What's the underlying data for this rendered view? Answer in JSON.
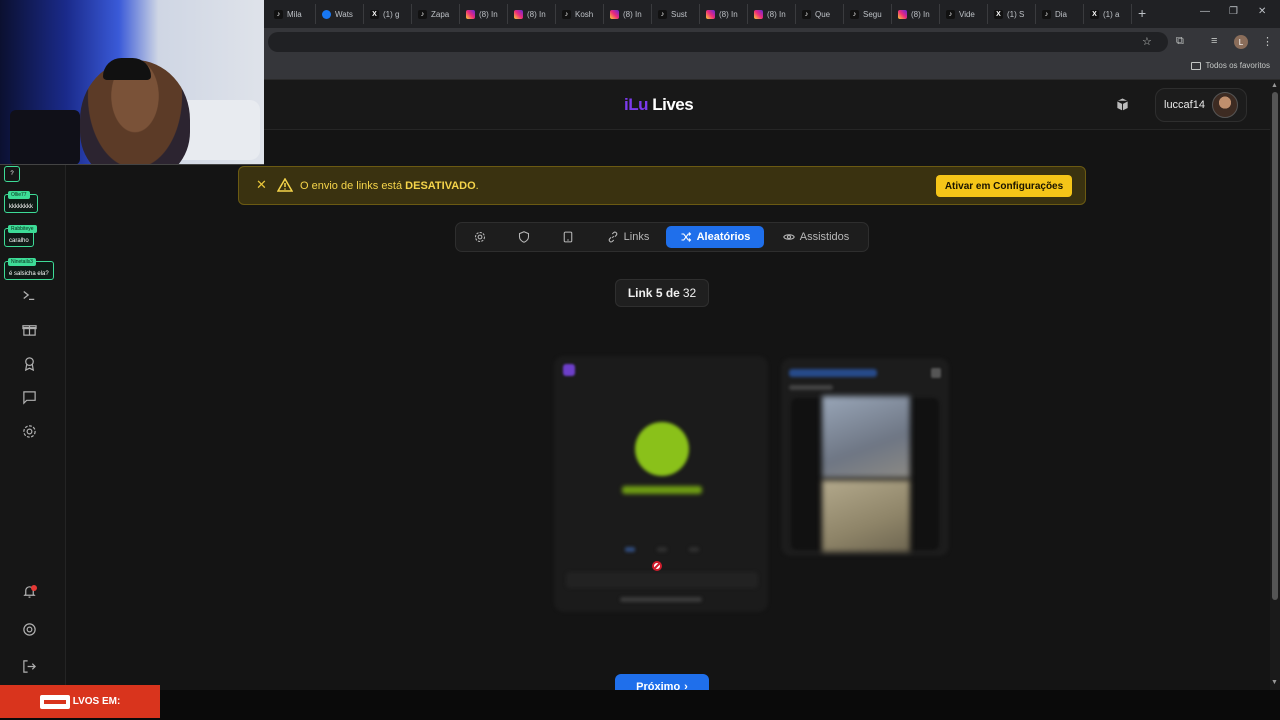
{
  "browser": {
    "tabs": [
      {
        "icon": "tiktok-icon",
        "label": "Mila"
      },
      {
        "icon": "meta-icon",
        "label": "Wats"
      },
      {
        "icon": "x-icon",
        "label": "(1) g"
      },
      {
        "icon": "tiktok-icon",
        "label": "Zapa"
      },
      {
        "icon": "instagram-icon",
        "label": "(8) In"
      },
      {
        "icon": "instagram-icon",
        "label": "(8) In"
      },
      {
        "icon": "tiktok-icon",
        "label": "Kosh"
      },
      {
        "icon": "instagram-icon",
        "label": "(8) In"
      },
      {
        "icon": "tiktok-icon",
        "label": "Sust"
      },
      {
        "icon": "instagram-icon",
        "label": "(8) In"
      },
      {
        "icon": "instagram-icon",
        "label": "(8) In"
      },
      {
        "icon": "tiktok-icon",
        "label": "Que"
      },
      {
        "icon": "tiktok-icon",
        "label": "Segu"
      },
      {
        "icon": "instagram-icon",
        "label": "(8) In"
      },
      {
        "icon": "tiktok-icon",
        "label": "Vide"
      },
      {
        "icon": "x-icon",
        "label": "(1) S"
      },
      {
        "icon": "tiktok-icon",
        "label": "Dia"
      },
      {
        "icon": "x-icon",
        "label": "(1) a"
      }
    ],
    "profile_initial": "L",
    "bookmarks_label": "Todos os favoritos"
  },
  "app": {
    "logo_part1": "iLu",
    "logo_part2": "Lives",
    "username": "luccaf14"
  },
  "chat": [
    {
      "tag": "Ollie77",
      "text": "kkkkkkkk"
    },
    {
      "tag": "Rabbiteye",
      "text": "caralho"
    },
    {
      "tag": "Ninetails3",
      "text": "é salsicha ela?"
    }
  ],
  "chat_question": "?",
  "banner": {
    "text_prefix": "O envio de links está ",
    "text_bold": "DESATIVADO",
    "text_suffix": ".",
    "button_label": "Ativar em Configurações"
  },
  "tabs": [
    {
      "name": "settings",
      "label": ""
    },
    {
      "name": "shield",
      "label": ""
    },
    {
      "name": "tablet",
      "label": ""
    },
    {
      "name": "links",
      "label": "Links"
    },
    {
      "name": "random",
      "label": "Aleatórios"
    },
    {
      "name": "watched",
      "label": "Assistidos"
    }
  ],
  "counter": {
    "prefix": "Link 5 de",
    "total": "32"
  },
  "next_button": {
    "label": "Próximo",
    "arrow": "›"
  },
  "live_badge": {
    "label": "LVOS EM:"
  },
  "colors": {
    "accent": "#1f6feb",
    "brand": "#7c3aed",
    "warning": "#f5c518"
  }
}
